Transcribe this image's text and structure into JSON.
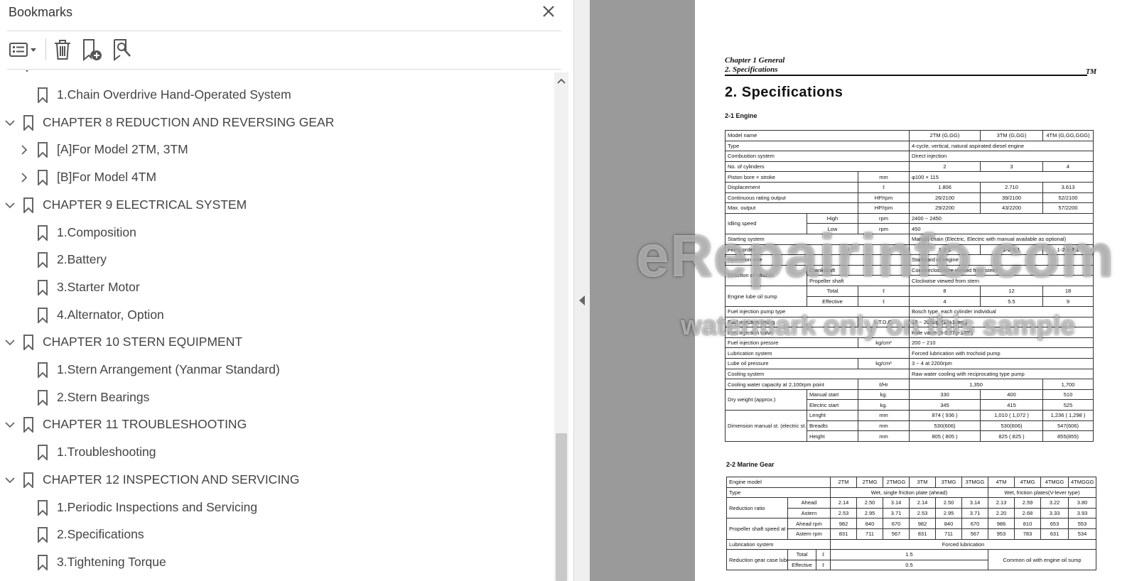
{
  "bookmarks_panel": {
    "title": "Bookmarks",
    "items": [
      {
        "label": "1.Chain Overdrive Hand-Operated System",
        "level": 1,
        "expander": "none"
      },
      {
        "label": "CHAPTER 8 REDUCTION AND REVERSING GEAR",
        "level": 0,
        "expander": "expanded"
      },
      {
        "label": "[A]For Model 2TM, 3TM",
        "level": 1,
        "expander": "collapsed"
      },
      {
        "label": "[B]For Model 4TM",
        "level": 1,
        "expander": "collapsed"
      },
      {
        "label": "CHAPTER 9 ELECTRICAL SYSTEM",
        "level": 0,
        "expander": "expanded"
      },
      {
        "label": "1.Composition",
        "level": 1,
        "expander": "none"
      },
      {
        "label": "2.Battery",
        "level": 1,
        "expander": "none"
      },
      {
        "label": "3.Starter Motor",
        "level": 1,
        "expander": "none"
      },
      {
        "label": "4.Alternator, Option",
        "level": 1,
        "expander": "none"
      },
      {
        "label": "CHAPTER 10 STERN EQUIPMENT",
        "level": 0,
        "expander": "expanded"
      },
      {
        "label": "1.Stern Arrangement (Yanmar Standard)",
        "level": 1,
        "expander": "none"
      },
      {
        "label": "2.Stern Bearings",
        "level": 1,
        "expander": "none"
      },
      {
        "label": "CHAPTER 11 TROUBLESHOOTING",
        "level": 0,
        "expander": "expanded"
      },
      {
        "label": "1.Troubleshooting",
        "level": 1,
        "expander": "none"
      },
      {
        "label": "CHAPTER 12 INSPECTION AND SERVICING",
        "level": 0,
        "expander": "expanded"
      },
      {
        "label": "1.Periodic Inspections and Servicing",
        "level": 1,
        "expander": "none"
      },
      {
        "label": "2.Specifications",
        "level": 1,
        "expander": "none"
      },
      {
        "label": "3.Tightening Torque",
        "level": 1,
        "expander": "none"
      }
    ],
    "toolbar_icons": [
      "options-menu-icon",
      "delete-bookmark-icon",
      "new-bookmark-icon",
      "find-bookmark-icon"
    ]
  },
  "page": {
    "chapter_header": "Chapter 1 General",
    "section_header": "2. Specifications",
    "tm_mark": "TM",
    "heading": "2. Specifications",
    "engine_heading": "2-1  Engine",
    "gear_heading": "2-2  Marine Gear",
    "engine_table": [
      [
        {
          "t": "Model name",
          "cs": 3
        },
        {
          "t": "2TM (G,GG)",
          "c": 1
        },
        {
          "t": "3TM (G,GG)",
          "c": 1
        },
        {
          "t": "4TM (G,GG,GGG)",
          "c": 1
        }
      ],
      [
        {
          "t": "Type",
          "cs": 3
        },
        {
          "t": "4-cycle, vertical, natural aspirated diesel engine",
          "cs": 3
        }
      ],
      [
        {
          "t": "Combustion system",
          "cs": 3
        },
        {
          "t": "Direct injection",
          "cs": 3
        }
      ],
      [
        {
          "t": "No. of cylinders",
          "cs": 3
        },
        {
          "t": "2",
          "c": 1
        },
        {
          "t": "3",
          "c": 1
        },
        {
          "t": "4",
          "c": 1
        }
      ],
      [
        {
          "t": "Piston bore × stroke",
          "cs": 2
        },
        {
          "t": "mm",
          "c": 1
        },
        {
          "t": "φ100 × 115",
          "cs": 3
        }
      ],
      [
        {
          "t": "Displacement",
          "cs": 2
        },
        {
          "t": "ℓ",
          "c": 1
        },
        {
          "t": "1.806",
          "c": 1
        },
        {
          "t": "2.710",
          "c": 1
        },
        {
          "t": "3.613",
          "c": 1
        }
      ],
      [
        {
          "t": "Continuous rating output",
          "cs": 2
        },
        {
          "t": "HP/rpm",
          "c": 1
        },
        {
          "t": "26/2100",
          "c": 1
        },
        {
          "t": "39/2100",
          "c": 1
        },
        {
          "t": "52/2100",
          "c": 1
        }
      ],
      [
        {
          "t": "Max. output",
          "cs": 2
        },
        {
          "t": "HP/rpm",
          "c": 1
        },
        {
          "t": "29/2200",
          "c": 1
        },
        {
          "t": "43/2200",
          "c": 1
        },
        {
          "t": "57/2200",
          "c": 1
        }
      ],
      [
        {
          "t": "Idling speed",
          "rs": 2
        },
        {
          "t": "High",
          "c": 1
        },
        {
          "t": "rpm",
          "c": 1
        },
        {
          "t": "2400 ~ 2450",
          "cs": 3
        }
      ],
      [
        {
          "t": "Low",
          "c": 1
        },
        {
          "t": "rpm",
          "c": 1
        },
        {
          "t": "450",
          "cs": 3
        }
      ],
      [
        {
          "t": "Starting system",
          "cs": 3
        },
        {
          "t": "Manual chain (Electric, Electric with manual available as optional)",
          "cs": 3
        }
      ],
      [
        {
          "t": "Firing order",
          "cs": 3
        },
        {
          "t": "1-2-1",
          "c": 1
        },
        {
          "t": "1-2-3-1",
          "c": 1
        },
        {
          "t": "1-2-4-3-1",
          "c": 1
        }
      ],
      [
        {
          "t": "Operation side",
          "cs": 3
        },
        {
          "t": "Starboard of engine",
          "cs": 3
        }
      ],
      [
        {
          "t": "Direction of rotation",
          "rs": 2
        },
        {
          "t": "Crankshaft",
          "cs": 2
        },
        {
          "t": "Counterclockwise viewed from stern",
          "cs": 3
        }
      ],
      [
        {
          "t": "Propeller shaft",
          "cs": 2
        },
        {
          "t": "Clockwise viewed from stern",
          "cs": 3
        }
      ],
      [
        {
          "t": "Engine lube oil sump",
          "rs": 2
        },
        {
          "t": "Total",
          "c": 1
        },
        {
          "t": "ℓ",
          "c": 1
        },
        {
          "t": "8",
          "c": 1
        },
        {
          "t": "12",
          "c": 1
        },
        {
          "t": "18",
          "c": 1
        }
      ],
      [
        {
          "t": "Effective",
          "c": 1
        },
        {
          "t": "ℓ",
          "c": 1
        },
        {
          "t": "4",
          "c": 1
        },
        {
          "t": "5.5",
          "c": 1
        },
        {
          "t": "9",
          "c": 1
        }
      ],
      [
        {
          "t": "Fuel injection pump type",
          "cs": 3
        },
        {
          "t": "Bosch type, each cylinder individual",
          "cs": 3
        }
      ],
      [
        {
          "t": "Fuel injection timing",
          "cs": 2
        },
        {
          "t": "b.T.D.C.",
          "c": 1
        },
        {
          "t": "18 ~ 20deg. (19±1deg.)",
          "cs": 3
        }
      ],
      [
        {
          "t": "Fuel injection valve",
          "cs": 3
        },
        {
          "t": "Hole valve (5-0.27φ-140°)",
          "cs": 3
        }
      ],
      [
        {
          "t": "Fuel injection pressre",
          "cs": 2
        },
        {
          "t": "kg/cm²",
          "c": 1
        },
        {
          "t": "200 ~ 210",
          "cs": 3
        }
      ],
      [
        {
          "t": "Lubrication system",
          "cs": 3
        },
        {
          "t": "Forced lubrication with trochoid pump",
          "cs": 3
        }
      ],
      [
        {
          "t": "Lube oil pressure",
          "cs": 2
        },
        {
          "t": "kg/cm²",
          "c": 1
        },
        {
          "t": "3 ~ 4 at 2200rpm",
          "cs": 3
        }
      ],
      [
        {
          "t": "Cooling system",
          "cs": 3
        },
        {
          "t": "Raw water cooling with reciprocating type pump",
          "cs": 3
        }
      ],
      [
        {
          "t": "Cooling water capacity at 2,100rpm point",
          "cs": 2
        },
        {
          "t": "ℓ/Hr",
          "c": 1
        },
        {
          "t": "1,350",
          "cs": 2,
          "c": 1
        },
        {
          "t": "1,700",
          "c": 1
        }
      ],
      [
        {
          "t": "Dry weight (approx.)",
          "rs": 2
        },
        {
          "t": "Manual start",
          "c": 0
        },
        {
          "t": "kg.",
          "c": 1
        },
        {
          "t": "330",
          "c": 1
        },
        {
          "t": "400",
          "c": 1
        },
        {
          "t": "510",
          "c": 1
        }
      ],
      [
        {
          "t": "Electric start",
          "c": 0
        },
        {
          "t": "kg.",
          "c": 1
        },
        {
          "t": "345",
          "c": 1
        },
        {
          "t": "415",
          "c": 1
        },
        {
          "t": "525",
          "c": 1
        }
      ],
      [
        {
          "t": "Dimension manual st. (electric st.)",
          "rs": 3
        },
        {
          "t": "Lenght",
          "c": 0
        },
        {
          "t": "mm",
          "c": 1
        },
        {
          "t": "874 ( 936 )",
          "c": 1
        },
        {
          "t": "1,010 ( 1,072 )",
          "c": 1
        },
        {
          "t": "1,236 ( 1,298 )",
          "c": 1
        }
      ],
      [
        {
          "t": "Breadts",
          "c": 0
        },
        {
          "t": "mm",
          "c": 1
        },
        {
          "t": "530(606)",
          "c": 1
        },
        {
          "t": "530(606)",
          "c": 1
        },
        {
          "t": "547(606)",
          "c": 1
        }
      ],
      [
        {
          "t": "Height",
          "c": 0
        },
        {
          "t": "mm",
          "c": 1
        },
        {
          "t": "805 ( 805 )",
          "c": 1
        },
        {
          "t": "825 ( 825 )",
          "c": 1
        },
        {
          "t": "855(855)",
          "c": 1
        }
      ]
    ],
    "gear_table": [
      [
        {
          "t": "Engine model",
          "cs": 3
        },
        {
          "t": "2TM",
          "c": 1
        },
        {
          "t": "2TMG",
          "c": 1
        },
        {
          "t": "2TMGG",
          "c": 1
        },
        {
          "t": "3TM",
          "c": 1
        },
        {
          "t": "3TMG",
          "c": 1
        },
        {
          "t": "3TMGG",
          "c": 1
        },
        {
          "t": "4TM",
          "c": 1
        },
        {
          "t": "4TMG",
          "c": 1
        },
        {
          "t": "4TMGG",
          "c": 1
        },
        {
          "t": "4TMGGG",
          "c": 1
        }
      ],
      [
        {
          "t": "Type",
          "cs": 3
        },
        {
          "t": "Wet, single friction plate (ahead)",
          "cs": 6,
          "c": 1
        },
        {
          "t": "Wet, friction plates(V-lever type)",
          "cs": 4,
          "c": 1
        }
      ],
      [
        {
          "t": "Reduction ratio",
          "rs": 2
        },
        {
          "t": "Ahead",
          "cs": 2,
          "c": 1
        },
        {
          "t": "2.14",
          "c": 1
        },
        {
          "t": "2.50",
          "c": 1
        },
        {
          "t": "3.14",
          "c": 1
        },
        {
          "t": "2.14",
          "c": 1
        },
        {
          "t": "2.50",
          "c": 1
        },
        {
          "t": "3.14",
          "c": 1
        },
        {
          "t": "2.13",
          "c": 1
        },
        {
          "t": "2.59",
          "c": 1
        },
        {
          "t": "3.22",
          "c": 1
        },
        {
          "t": "3.80",
          "c": 1
        }
      ],
      [
        {
          "t": "Astern",
          "cs": 2,
          "c": 1
        },
        {
          "t": "2.53",
          "c": 1
        },
        {
          "t": "2.95",
          "c": 1
        },
        {
          "t": "3.71",
          "c": 1
        },
        {
          "t": "2.53",
          "c": 1
        },
        {
          "t": "2.95",
          "c": 1
        },
        {
          "t": "3.71",
          "c": 1
        },
        {
          "t": "2.20",
          "c": 1
        },
        {
          "t": "2.68",
          "c": 1
        },
        {
          "t": "3.33",
          "c": 1
        },
        {
          "t": "3.93",
          "c": 1
        }
      ],
      [
        {
          "t": "Propeller shaft speed at engine 2,100rpm",
          "rs": 2
        },
        {
          "t": "Ahead rpm",
          "cs": 2,
          "c": 1
        },
        {
          "t": "982",
          "c": 1
        },
        {
          "t": "840",
          "c": 1
        },
        {
          "t": "670",
          "c": 1
        },
        {
          "t": "982",
          "c": 1
        },
        {
          "t": "840",
          "c": 1
        },
        {
          "t": "670",
          "c": 1
        },
        {
          "t": "986",
          "c": 1
        },
        {
          "t": "810",
          "c": 1
        },
        {
          "t": "653",
          "c": 1
        },
        {
          "t": "553",
          "c": 1
        }
      ],
      [
        {
          "t": "Astern rpm",
          "cs": 2,
          "c": 1
        },
        {
          "t": "831",
          "c": 1
        },
        {
          "t": "711",
          "c": 1
        },
        {
          "t": "567",
          "c": 1
        },
        {
          "t": "831",
          "c": 1
        },
        {
          "t": "711",
          "c": 1
        },
        {
          "t": "567",
          "c": 1
        },
        {
          "t": "953",
          "c": 1
        },
        {
          "t": "783",
          "c": 1
        },
        {
          "t": "631",
          "c": 1
        },
        {
          "t": "534",
          "c": 1
        }
      ],
      [
        {
          "t": "Lubrication system",
          "cs": 3
        },
        {
          "t": "Forced lubrication",
          "cs": 10,
          "c": 1
        }
      ],
      [
        {
          "t": "Reduction gear case lube oil sump",
          "rs": 2
        },
        {
          "t": "Total",
          "c": 1
        },
        {
          "t": "ℓ",
          "c": 1
        },
        {
          "t": "1.5",
          "cs": 6,
          "c": 1
        },
        {
          "t": "Common oil with engine oil sump",
          "cs": 4,
          "rs": 2,
          "c": 1
        }
      ],
      [
        {
          "t": "Effective",
          "c": 1
        },
        {
          "t": "ℓ",
          "c": 1
        },
        {
          "t": "0.5",
          "cs": 6,
          "c": 1
        }
      ]
    ],
    "watermark_main": "eRepairinfo.com",
    "watermark_sub": "watermark only on this sample"
  }
}
